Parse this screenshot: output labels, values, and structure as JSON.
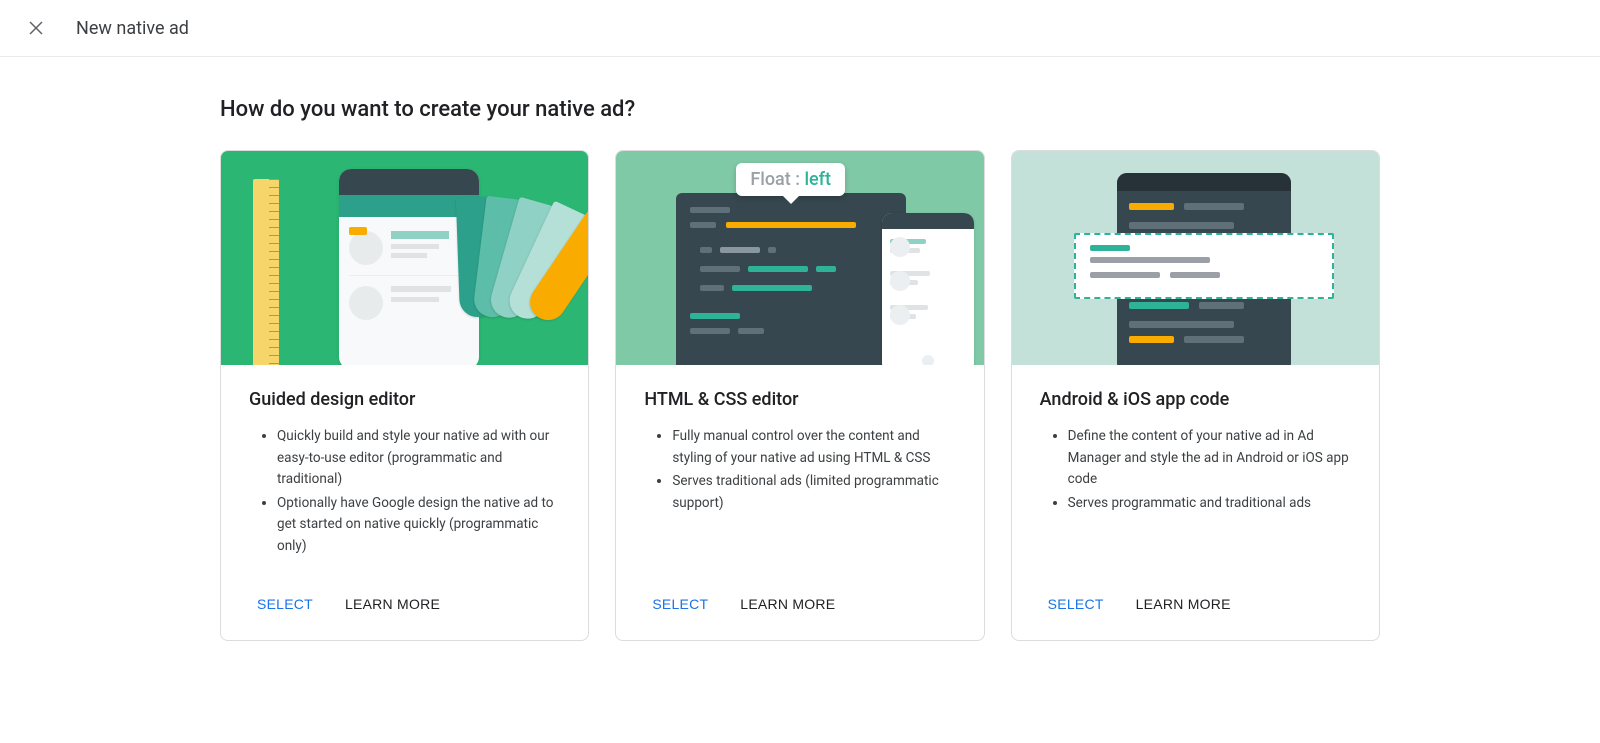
{
  "header": {
    "title": "New native ad"
  },
  "question": "How do you want to create your native ad?",
  "cards": [
    {
      "title": "Guided design editor",
      "bullets": [
        "Quickly build and style your native ad with our easy-to-use editor (programmatic and traditional)",
        "Optionally have Google design the native ad to get started on native quickly (programmatic only)"
      ],
      "select_label": "SELECT",
      "learn_label": "LEARN MORE"
    },
    {
      "title": "HTML & CSS editor",
      "bullets": [
        "Fully manual control over the content and styling of your native ad using HTML & CSS",
        "Serves traditional ads (limited programmatic support)"
      ],
      "select_label": "SELECT",
      "learn_label": "LEARN MORE",
      "tooltip_key": "Float :",
      "tooltip_val": "left"
    },
    {
      "title": "Android & iOS app code",
      "bullets": [
        "Define the content of your native ad in Ad Manager and style the ad in Android or iOS app code",
        "Serves programmatic and traditional ads"
      ],
      "select_label": "SELECT",
      "learn_label": "LEARN MORE"
    }
  ]
}
